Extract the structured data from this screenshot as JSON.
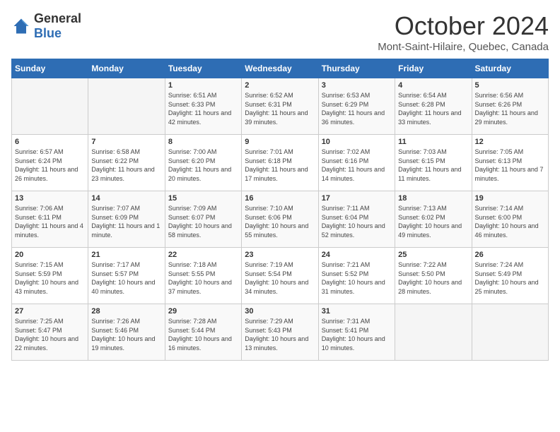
{
  "header": {
    "logo_general": "General",
    "logo_blue": "Blue",
    "month": "October 2024",
    "location": "Mont-Saint-Hilaire, Quebec, Canada"
  },
  "weekdays": [
    "Sunday",
    "Monday",
    "Tuesday",
    "Wednesday",
    "Thursday",
    "Friday",
    "Saturday"
  ],
  "weeks": [
    [
      {
        "day": "",
        "sunrise": "",
        "sunset": "",
        "daylight": ""
      },
      {
        "day": "",
        "sunrise": "",
        "sunset": "",
        "daylight": ""
      },
      {
        "day": "1",
        "sunrise": "Sunrise: 6:51 AM",
        "sunset": "Sunset: 6:33 PM",
        "daylight": "Daylight: 11 hours and 42 minutes."
      },
      {
        "day": "2",
        "sunrise": "Sunrise: 6:52 AM",
        "sunset": "Sunset: 6:31 PM",
        "daylight": "Daylight: 11 hours and 39 minutes."
      },
      {
        "day": "3",
        "sunrise": "Sunrise: 6:53 AM",
        "sunset": "Sunset: 6:29 PM",
        "daylight": "Daylight: 11 hours and 36 minutes."
      },
      {
        "day": "4",
        "sunrise": "Sunrise: 6:54 AM",
        "sunset": "Sunset: 6:28 PM",
        "daylight": "Daylight: 11 hours and 33 minutes."
      },
      {
        "day": "5",
        "sunrise": "Sunrise: 6:56 AM",
        "sunset": "Sunset: 6:26 PM",
        "daylight": "Daylight: 11 hours and 29 minutes."
      }
    ],
    [
      {
        "day": "6",
        "sunrise": "Sunrise: 6:57 AM",
        "sunset": "Sunset: 6:24 PM",
        "daylight": "Daylight: 11 hours and 26 minutes."
      },
      {
        "day": "7",
        "sunrise": "Sunrise: 6:58 AM",
        "sunset": "Sunset: 6:22 PM",
        "daylight": "Daylight: 11 hours and 23 minutes."
      },
      {
        "day": "8",
        "sunrise": "Sunrise: 7:00 AM",
        "sunset": "Sunset: 6:20 PM",
        "daylight": "Daylight: 11 hours and 20 minutes."
      },
      {
        "day": "9",
        "sunrise": "Sunrise: 7:01 AM",
        "sunset": "Sunset: 6:18 PM",
        "daylight": "Daylight: 11 hours and 17 minutes."
      },
      {
        "day": "10",
        "sunrise": "Sunrise: 7:02 AM",
        "sunset": "Sunset: 6:16 PM",
        "daylight": "Daylight: 11 hours and 14 minutes."
      },
      {
        "day": "11",
        "sunrise": "Sunrise: 7:03 AM",
        "sunset": "Sunset: 6:15 PM",
        "daylight": "Daylight: 11 hours and 11 minutes."
      },
      {
        "day": "12",
        "sunrise": "Sunrise: 7:05 AM",
        "sunset": "Sunset: 6:13 PM",
        "daylight": "Daylight: 11 hours and 7 minutes."
      }
    ],
    [
      {
        "day": "13",
        "sunrise": "Sunrise: 7:06 AM",
        "sunset": "Sunset: 6:11 PM",
        "daylight": "Daylight: 11 hours and 4 minutes."
      },
      {
        "day": "14",
        "sunrise": "Sunrise: 7:07 AM",
        "sunset": "Sunset: 6:09 PM",
        "daylight": "Daylight: 11 hours and 1 minute."
      },
      {
        "day": "15",
        "sunrise": "Sunrise: 7:09 AM",
        "sunset": "Sunset: 6:07 PM",
        "daylight": "Daylight: 10 hours and 58 minutes."
      },
      {
        "day": "16",
        "sunrise": "Sunrise: 7:10 AM",
        "sunset": "Sunset: 6:06 PM",
        "daylight": "Daylight: 10 hours and 55 minutes."
      },
      {
        "day": "17",
        "sunrise": "Sunrise: 7:11 AM",
        "sunset": "Sunset: 6:04 PM",
        "daylight": "Daylight: 10 hours and 52 minutes."
      },
      {
        "day": "18",
        "sunrise": "Sunrise: 7:13 AM",
        "sunset": "Sunset: 6:02 PM",
        "daylight": "Daylight: 10 hours and 49 minutes."
      },
      {
        "day": "19",
        "sunrise": "Sunrise: 7:14 AM",
        "sunset": "Sunset: 6:00 PM",
        "daylight": "Daylight: 10 hours and 46 minutes."
      }
    ],
    [
      {
        "day": "20",
        "sunrise": "Sunrise: 7:15 AM",
        "sunset": "Sunset: 5:59 PM",
        "daylight": "Daylight: 10 hours and 43 minutes."
      },
      {
        "day": "21",
        "sunrise": "Sunrise: 7:17 AM",
        "sunset": "Sunset: 5:57 PM",
        "daylight": "Daylight: 10 hours and 40 minutes."
      },
      {
        "day": "22",
        "sunrise": "Sunrise: 7:18 AM",
        "sunset": "Sunset: 5:55 PM",
        "daylight": "Daylight: 10 hours and 37 minutes."
      },
      {
        "day": "23",
        "sunrise": "Sunrise: 7:19 AM",
        "sunset": "Sunset: 5:54 PM",
        "daylight": "Daylight: 10 hours and 34 minutes."
      },
      {
        "day": "24",
        "sunrise": "Sunrise: 7:21 AM",
        "sunset": "Sunset: 5:52 PM",
        "daylight": "Daylight: 10 hours and 31 minutes."
      },
      {
        "day": "25",
        "sunrise": "Sunrise: 7:22 AM",
        "sunset": "Sunset: 5:50 PM",
        "daylight": "Daylight: 10 hours and 28 minutes."
      },
      {
        "day": "26",
        "sunrise": "Sunrise: 7:24 AM",
        "sunset": "Sunset: 5:49 PM",
        "daylight": "Daylight: 10 hours and 25 minutes."
      }
    ],
    [
      {
        "day": "27",
        "sunrise": "Sunrise: 7:25 AM",
        "sunset": "Sunset: 5:47 PM",
        "daylight": "Daylight: 10 hours and 22 minutes."
      },
      {
        "day": "28",
        "sunrise": "Sunrise: 7:26 AM",
        "sunset": "Sunset: 5:46 PM",
        "daylight": "Daylight: 10 hours and 19 minutes."
      },
      {
        "day": "29",
        "sunrise": "Sunrise: 7:28 AM",
        "sunset": "Sunset: 5:44 PM",
        "daylight": "Daylight: 10 hours and 16 minutes."
      },
      {
        "day": "30",
        "sunrise": "Sunrise: 7:29 AM",
        "sunset": "Sunset: 5:43 PM",
        "daylight": "Daylight: 10 hours and 13 minutes."
      },
      {
        "day": "31",
        "sunrise": "Sunrise: 7:31 AM",
        "sunset": "Sunset: 5:41 PM",
        "daylight": "Daylight: 10 hours and 10 minutes."
      },
      {
        "day": "",
        "sunrise": "",
        "sunset": "",
        "daylight": ""
      },
      {
        "day": "",
        "sunrise": "",
        "sunset": "",
        "daylight": ""
      }
    ]
  ]
}
